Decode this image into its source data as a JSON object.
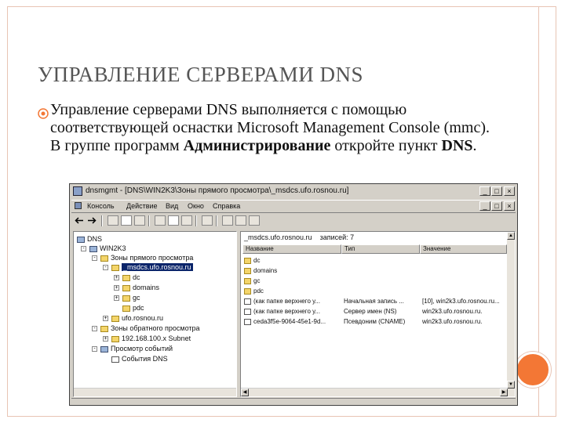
{
  "slide": {
    "title": "УПРАВЛЕНИЕ СЕРВЕРАМИ DNS",
    "body_part1": "Управление серверами DNS выполняется с помощью соответствующей оснастки Microsoft Management Console (mmc). В группе программ ",
    "body_bold1": "Администрирование",
    "body_part2": " откройте пункт ",
    "body_bold2": "DNS",
    "body_part3": "."
  },
  "window": {
    "title": "dnsmgmt - [DNS\\WIN2K3\\Зоны прямого просмотра\\_msdcs.ufo.rosnou.ru]",
    "buttons": [
      "_",
      "□",
      "×"
    ],
    "inner_buttons": [
      "_",
      "□",
      "×"
    ]
  },
  "menu": [
    "Консоль",
    "Действие",
    "Вид",
    "Окно",
    "Справка"
  ],
  "tree": {
    "items": [
      {
        "label": "DNS",
        "icon": "dns-icon"
      },
      {
        "label": "WIN2K3",
        "icon": "server-icon"
      },
      {
        "label": "Зоны прямого просмотра",
        "icon": "folder-icon"
      },
      {
        "label": "_msdcs.ufo.rosnou.ru",
        "icon": "zone-icon"
      },
      {
        "label": "dc",
        "icon": "folder-icon"
      },
      {
        "label": "domains",
        "icon": "folder-icon"
      },
      {
        "label": "gc",
        "icon": "folder-icon"
      },
      {
        "label": "pdc",
        "icon": "folder-icon"
      },
      {
        "label": "ufo.rosnou.ru",
        "icon": "zone-icon"
      },
      {
        "label": "Зоны обратного просмотра",
        "icon": "folder-icon"
      },
      {
        "label": "192.168.100.x Subnet",
        "icon": "zone-icon"
      },
      {
        "label": "Просмотр событий",
        "icon": "events-icon"
      },
      {
        "label": "События DNS",
        "icon": "log-icon"
      }
    ]
  },
  "list": {
    "header_zone": "_msdcs.ufo.rosnou.ru",
    "header_count": "записей: 7",
    "columns": [
      "Название",
      "Тип",
      "Значение"
    ],
    "rows": [
      {
        "name": "dc",
        "type": "",
        "value": "",
        "icon": "folder-icon"
      },
      {
        "name": "domains",
        "type": "",
        "value": "",
        "icon": "folder-icon"
      },
      {
        "name": "gc",
        "type": "",
        "value": "",
        "icon": "folder-icon"
      },
      {
        "name": "pdc",
        "type": "",
        "value": "",
        "icon": "folder-icon"
      },
      {
        "name": "(как папке верхнего у...",
        "type": "Начальная запись ...",
        "value": "[10], win2k3.ufo.rosnou.ru...",
        "icon": "record-icon"
      },
      {
        "name": "(как папке верхнего у...",
        "type": "Сервер имен (NS)",
        "value": "win2k3.ufo.rosnou.ru.",
        "icon": "record-icon"
      },
      {
        "name": "ceda3f5e-9064-45e1-9d...",
        "type": "Псевдоним (CNAME)",
        "value": "win2k3.ufo.rosnou.ru.",
        "icon": "record-icon"
      }
    ]
  },
  "colors": {
    "accent": "#f37735",
    "frame": "#e8c4b4",
    "title_text": "#555555",
    "win_face": "#d4d0c8",
    "selection": "#0a246a"
  }
}
